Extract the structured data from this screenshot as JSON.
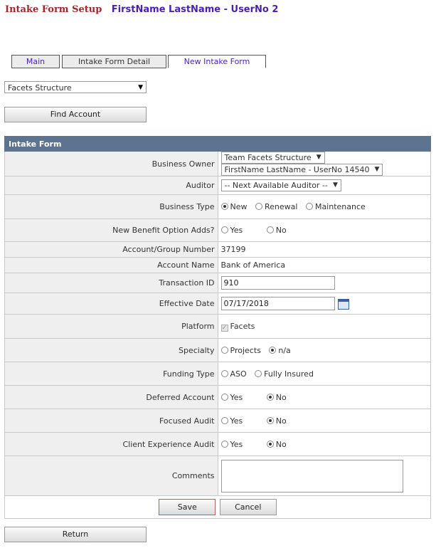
{
  "header": {
    "title": "Intake Form Setup",
    "user": "FirstName LastName - UserNo 2"
  },
  "tabs": [
    {
      "label": "Main"
    },
    {
      "label": "Intake Form Detail"
    },
    {
      "label": "New Intake Form"
    }
  ],
  "structure_select": {
    "value": "Facets Structure"
  },
  "find_account_label": "Find Account",
  "form": {
    "heading": "Intake Form",
    "business_owner": {
      "label": "Business Owner",
      "team": "Team Facets Structure",
      "person": "FirstName LastName - UserNo 14540"
    },
    "auditor": {
      "label": "Auditor",
      "value": "-- Next Available Auditor --"
    },
    "business_type": {
      "label": "Business Type",
      "options": [
        "New",
        "Renewal",
        "Maintenance"
      ],
      "selected": "New"
    },
    "new_benefit": {
      "label": "New Benefit Option Adds?",
      "options": [
        "Yes",
        "No"
      ]
    },
    "account_group": {
      "label": "Account/Group Number",
      "value": "37199"
    },
    "account_name": {
      "label": "Account Name",
      "value": "Bank of America"
    },
    "transaction_id": {
      "label": "Transaction ID",
      "value": "910"
    },
    "effective_date": {
      "label": "Effective Date",
      "value": "07/17/2018"
    },
    "platform": {
      "label": "Platform",
      "option": "Facets"
    },
    "specialty": {
      "label": "Specialty",
      "options": [
        "Projects",
        "n/a"
      ],
      "selected": "n/a"
    },
    "funding_type": {
      "label": "Funding Type",
      "options": [
        "ASO",
        "Fully Insured"
      ]
    },
    "deferred_account": {
      "label": "Deferred Account",
      "options": [
        "Yes",
        "No"
      ],
      "selected": "No"
    },
    "focused_audit": {
      "label": "Focused Audit",
      "options": [
        "Yes",
        "No"
      ],
      "selected": "No"
    },
    "client_experience": {
      "label": "Client Experience Audit",
      "options": [
        "Yes",
        "No"
      ],
      "selected": "No"
    },
    "comments": {
      "label": "Comments",
      "value": ""
    },
    "save_label": "Save",
    "cancel_label": "Cancel"
  },
  "return_label": "Return"
}
